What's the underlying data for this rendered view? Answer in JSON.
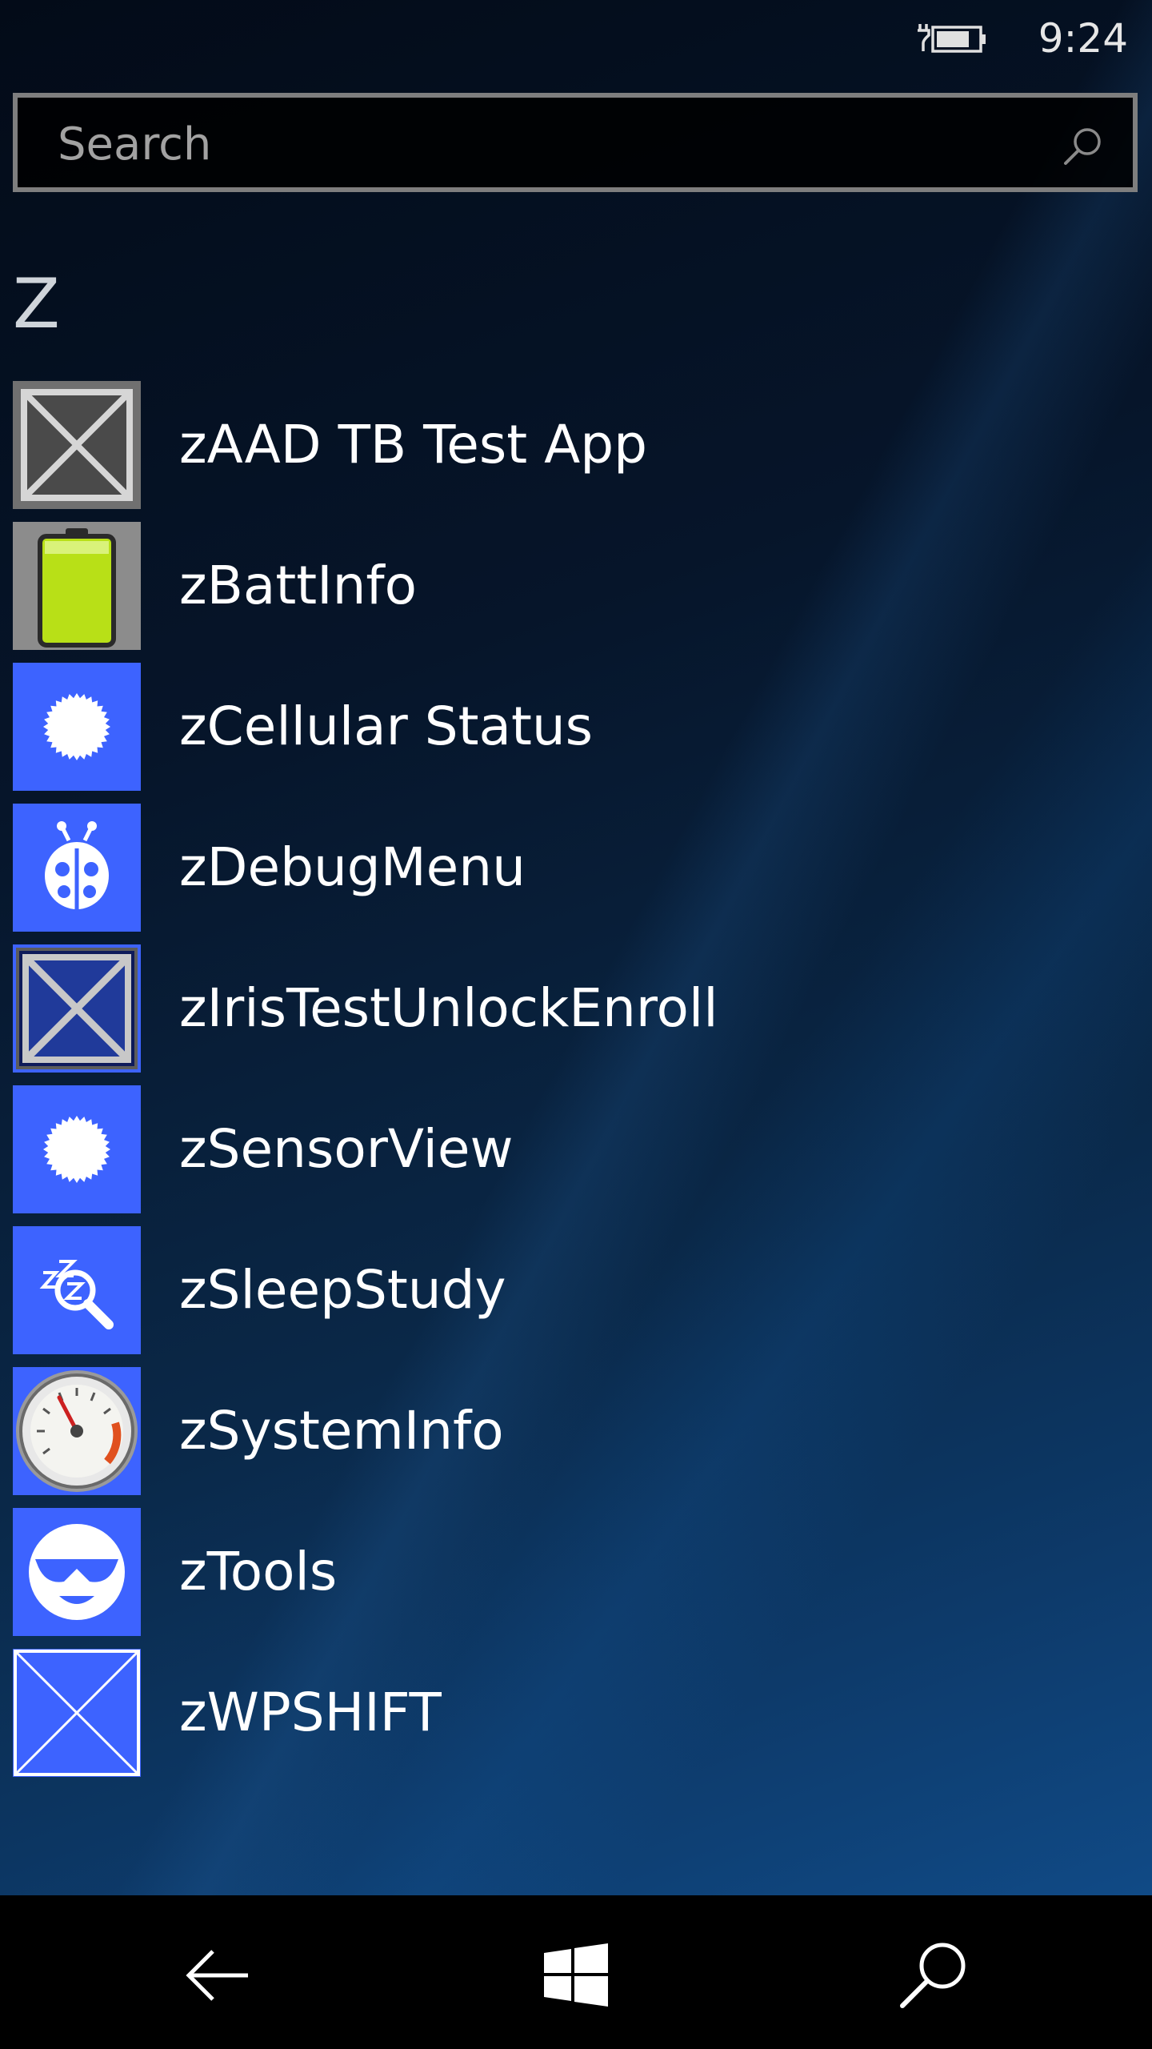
{
  "status_bar": {
    "time": "9:24",
    "battery_icon": "battery-charging-icon"
  },
  "search": {
    "placeholder": "Search",
    "icon": "search-icon"
  },
  "section": {
    "letter": "Z"
  },
  "apps": [
    {
      "label": "zAAD TB Test App",
      "icon": "placeholder-x-icon"
    },
    {
      "label": "zBattInfo",
      "icon": "battery-icon"
    },
    {
      "label": "zCellular Status",
      "icon": "starburst-icon"
    },
    {
      "label": "zDebugMenu",
      "icon": "ladybug-icon"
    },
    {
      "label": "zIrisTestUnlockEnroll",
      "icon": "placeholder-x-icon"
    },
    {
      "label": "zSensorView",
      "icon": "starburst-icon"
    },
    {
      "label": "zSleepStudy",
      "icon": "sleep-magnifier-icon"
    },
    {
      "label": "zSystemInfo",
      "icon": "gauge-icon"
    },
    {
      "label": "zTools",
      "icon": "sunglasses-smiley-icon"
    },
    {
      "label": "zWPSHIFT",
      "icon": "placeholder-x-icon"
    }
  ],
  "nav_bar": {
    "back": "back-arrow-icon",
    "start": "windows-logo-icon",
    "search": "search-icon"
  },
  "colors": {
    "tile_blue": "#3d63ff",
    "tile_gray": "#707070",
    "battery_green": "#b8e017",
    "nav_background": "#000000"
  }
}
